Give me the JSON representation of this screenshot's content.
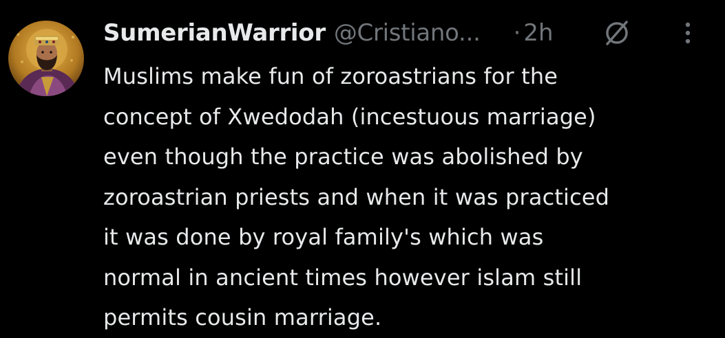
{
  "tweet": {
    "display_name": "SumerianWarrior",
    "handle": "@Cristiano...",
    "separator": "·",
    "time": "2h",
    "avatar_icon": "byzantine-mosaic-portrait-avatar",
    "grok_icon": "grok-icon",
    "more_icon": "more-options-icon",
    "text_lines": [
      "Muslims make fun of zoroastrians for the",
      "concept of Xwedodah (incestuous marriage)",
      "even though the practice was abolished by",
      "zoroastrian priests and when it was practiced",
      "it was done by royal family's which was",
      "normal in ancient times however islam still",
      "permits cousin marriage."
    ]
  },
  "colors": {
    "background": "#000000",
    "primary_text": "#e7e9ea",
    "secondary_text": "#71767b"
  }
}
